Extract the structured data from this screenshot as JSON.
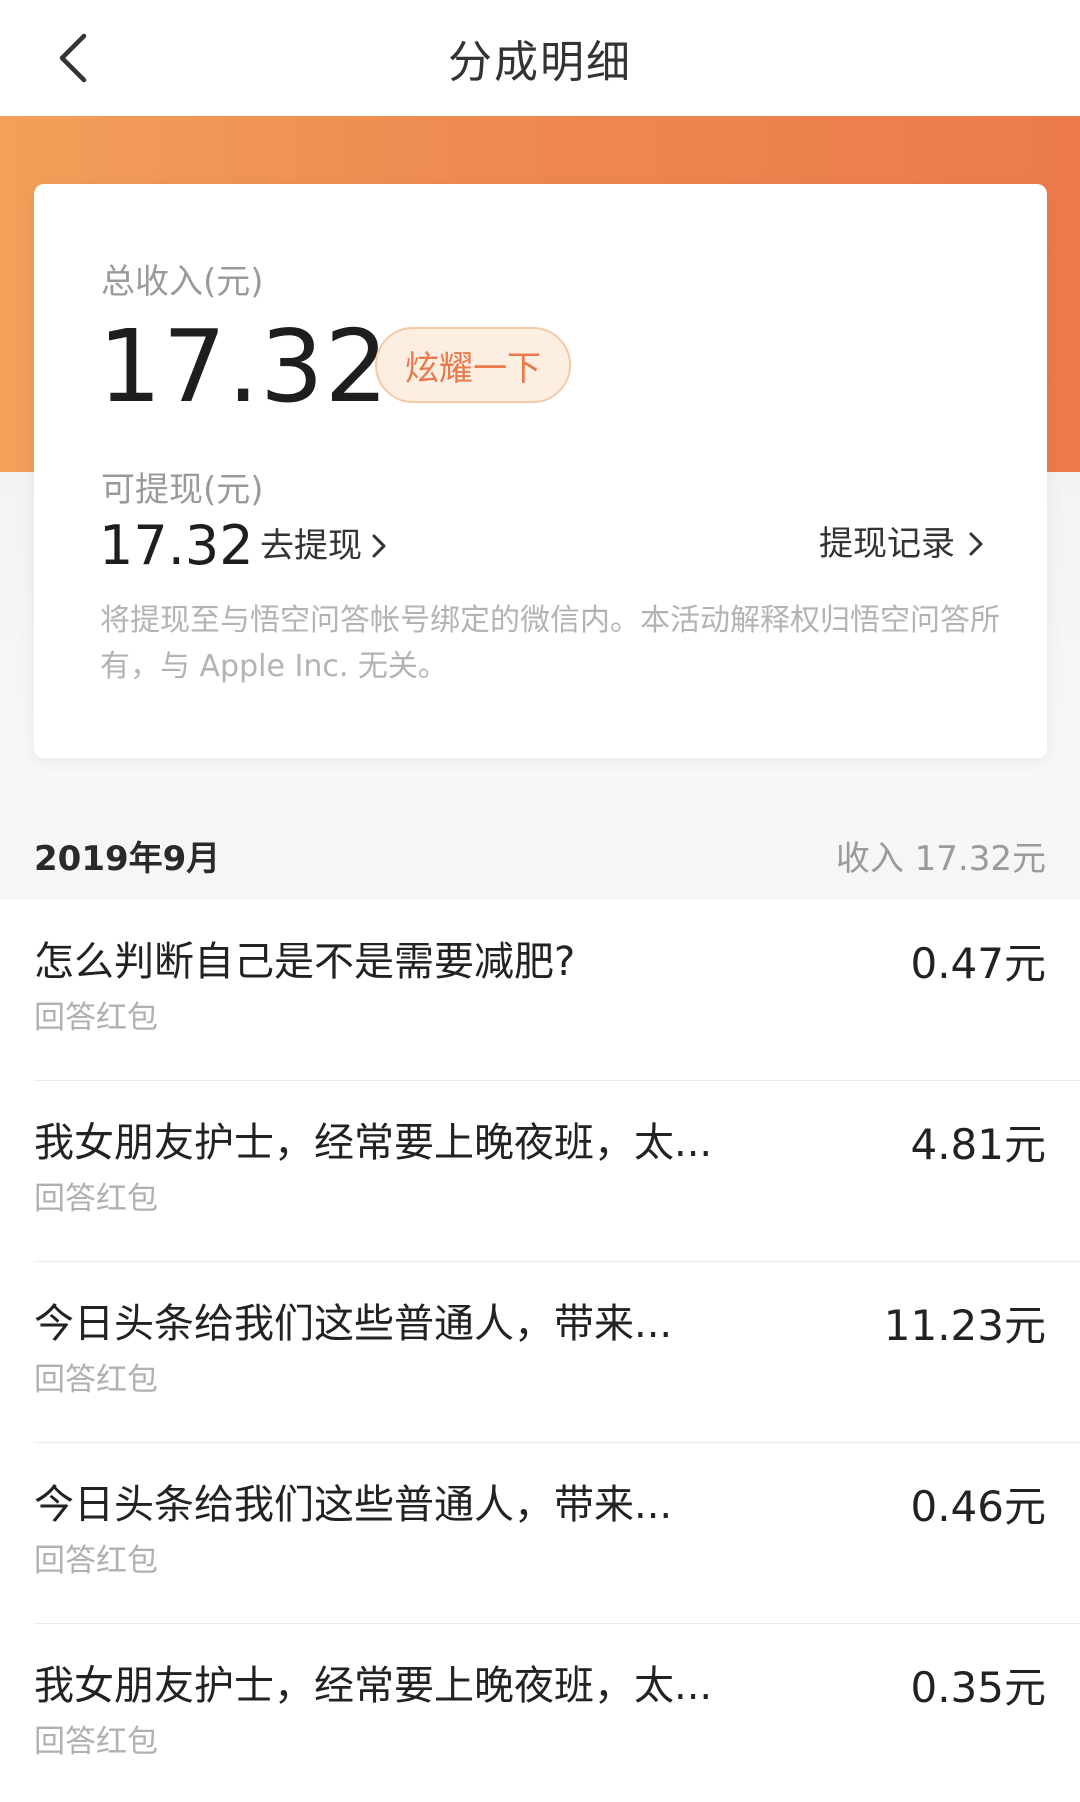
{
  "header": {
    "title": "分成明细"
  },
  "summary": {
    "total_label": "总收入(元)",
    "total_amount": "17.32",
    "show_off_label": "炫耀一下",
    "withdrawable_label": "可提现(元)",
    "withdrawable_amount": "17.32",
    "go_withdraw_label": "去提现",
    "withdraw_records_label": "提现记录",
    "notice": "将提现至与悟空问答帐号绑定的微信内。本活动解释权归悟空问答所有，与 Apple Inc. 无关。"
  },
  "month": {
    "label": "2019年9月",
    "income": "收入 17.32元"
  },
  "items": [
    {
      "title": "怎么判断自己是不是需要减肥?",
      "sub": "回答红包",
      "amount": "0.47元"
    },
    {
      "title": "我女朋友护士，经常要上晚夜班，太...",
      "sub": "回答红包",
      "amount": "4.81元"
    },
    {
      "title": "今日头条给我们这些普通人，带来...",
      "sub": "回答红包",
      "amount": "11.23元"
    },
    {
      "title": "今日头条给我们这些普通人，带来...",
      "sub": "回答红包",
      "amount": "0.46元"
    },
    {
      "title": "我女朋友护士，经常要上晚夜班，太...",
      "sub": "回答红包",
      "amount": "0.35元"
    }
  ],
  "colors": {
    "accent": "#ec7a4c",
    "banner_start": "#f2a05a",
    "badge_bg": "#fdeee2",
    "badge_text": "#e9784b"
  },
  "icons": {
    "back": "back-arrow-icon",
    "chevron": "chevron-right-icon"
  }
}
